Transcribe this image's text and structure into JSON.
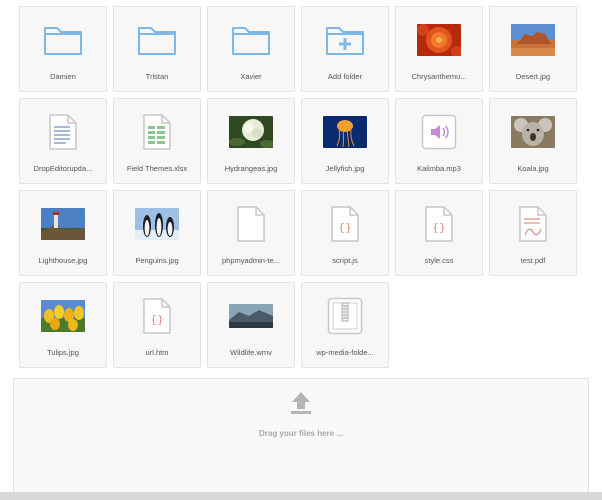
{
  "items": [
    {
      "name": "Damien",
      "icon": "folder-icon"
    },
    {
      "name": "Tristan",
      "icon": "folder-icon"
    },
    {
      "name": "Xavier",
      "icon": "folder-icon"
    },
    {
      "name": "Add folder",
      "icon": "add-folder-icon"
    },
    {
      "name": "Chrysanthemu...",
      "icon": "image-thumbnail"
    },
    {
      "name": "Desert.jpg",
      "icon": "image-thumbnail"
    },
    {
      "name": "DropEditorupda...",
      "icon": "document-icon"
    },
    {
      "name": "Field Themes.xlsx",
      "icon": "spreadsheet-icon"
    },
    {
      "name": "Hydrangeas.jpg",
      "icon": "image-thumbnail"
    },
    {
      "name": "Jellyfish.jpg",
      "icon": "image-thumbnail"
    },
    {
      "name": "Kalimba.mp3",
      "icon": "audio-icon"
    },
    {
      "name": "Koala.jpg",
      "icon": "image-thumbnail"
    },
    {
      "name": "Lighthouse.jpg",
      "icon": "image-thumbnail"
    },
    {
      "name": "Penguins.jpg",
      "icon": "image-thumbnail"
    },
    {
      "name": "phpmyadmin-te...",
      "icon": "blank-file-icon"
    },
    {
      "name": "script.js",
      "icon": "code-file-icon"
    },
    {
      "name": "style.css",
      "icon": "code-file-icon"
    },
    {
      "name": "test.pdf",
      "icon": "pdf-icon"
    },
    {
      "name": "Tulips.jpg",
      "icon": "image-thumbnail"
    },
    {
      "name": "url.htm",
      "icon": "code-file-icon"
    },
    {
      "name": "Wildlife.wmv",
      "icon": "video-thumbnail"
    },
    {
      "name": "wp-media-folde...",
      "icon": "zip-archive-icon"
    }
  ],
  "dropzone": {
    "text": "Drag your files here ...",
    "icon": "upload-arrow-icon"
  },
  "colors": {
    "folder": "#7fb8e6",
    "document": "#8aa4c8",
    "spreadsheet": "#8cc68c",
    "audio": "#c78bd6",
    "code": "#e08a80",
    "file_outline": "#c7c7c7"
  }
}
